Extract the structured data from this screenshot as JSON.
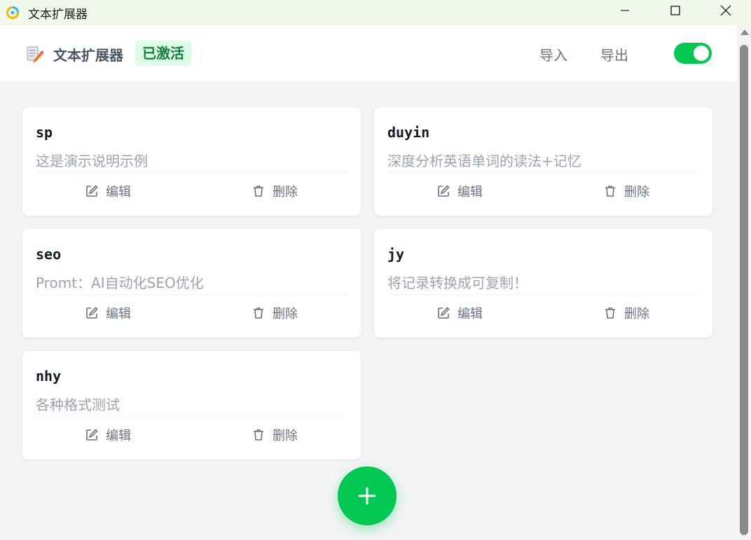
{
  "window": {
    "title": "文本扩展器"
  },
  "header": {
    "app_name": "文本扩展器",
    "status_badge": "已激活",
    "import_label": "导入",
    "export_label": "导出",
    "toggle_on": true
  },
  "cards": [
    {
      "name": "sp",
      "desc": "这是演示说明示例",
      "edit": "编辑",
      "delete": "删除"
    },
    {
      "name": "duyin",
      "desc": "深度分析英语单词的读法+记忆",
      "edit": "编辑",
      "delete": "删除"
    },
    {
      "name": "seo",
      "desc": "Promt：AI自动化SEO优化",
      "edit": "编辑",
      "delete": "删除"
    },
    {
      "name": "jy",
      "desc": "将记录转换成可复制！",
      "edit": "编辑",
      "delete": "删除"
    },
    {
      "name": "nhy",
      "desc": "各种格式测试",
      "edit": "编辑",
      "delete": "删除"
    }
  ],
  "colors": {
    "accent": "#00c853",
    "badge_bg": "#dcfce7",
    "badge_text": "#15803d"
  },
  "icons": {
    "add": "plus-icon",
    "edit": "pencil-square-icon",
    "delete": "trash-icon"
  }
}
